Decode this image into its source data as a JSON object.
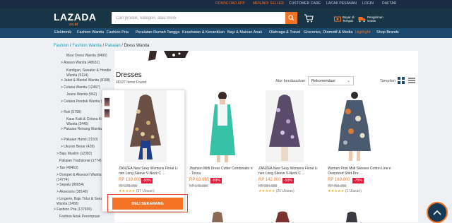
{
  "topbar": {
    "links": [
      "DOWNLOAD APP",
      "MENJADI SELLER",
      "CUSTOMER CARE",
      "LACAK PESANAN",
      "LOGIN",
      "DAFTAR"
    ]
  },
  "header": {
    "logo": "LAZADA",
    "logo_sub": ".co.id",
    "search_placeholder": "Cari produk, kategori, atau merk",
    "util1": "Bayar di Tempat",
    "util2": "Pengiriman Gratis"
  },
  "nav": {
    "items": [
      "Elektronik",
      "Fashion Wanita",
      "Fashion Pria",
      "Peralatan Rumah Tangga",
      "Kesehatan & Kecantikan",
      "Bayi & Mainan Anak",
      "Olahraga & Travel",
      "Groceries, Otomotif & Media",
      "Highlight",
      "Shop Brands"
    ]
  },
  "breadcrumb": {
    "fashion": "Fashion",
    "wanita": "Fashion Wanita",
    "pakaian": "Pakaian",
    "current": "Dress Wanita",
    "sep": "/"
  },
  "sidebar": {
    "items": [
      "Maxi Dress Wanita (8490)",
      "> Atasan Wanita (48631)",
      "Kardigan, Sweater & Hoodie Wanita (9114)",
      "> Jaket & Mantel Wanita (8198)",
      "> Celana Wanita (12467)",
      "Jeans Wanita (962)",
      "> Celana Pendek Wanita (1584)",
      "> Rok (5799)",
      "Kaus Kaki & Celana Ketat Wanita (3445)",
      "> Pakaian Renang Wanita (1663)",
      "> Pakaian Hamil (2150)",
      "> Ukuran Besar (439)",
      "> Baju Muslim (12082)",
      "Pakaian Tradisional (1774)",
      "> Tas (48463)",
      "> Dompet & Aksesori Wanita (14774)",
      "> Sepatu (86654)",
      "> Aksesoris (38148)",
      "> Lingerie, Baju Tidur & Sarung Wanita (3458)",
      "> Fashion Pria (137936)",
      "Fashion Anak Perempuan"
    ]
  },
  "listing": {
    "title": "Dresses",
    "count": "48327 Items Found",
    "sort_label": "Atur berdasarkan:",
    "sort_value": "Rekomendasi",
    "view_label": "Tampilan"
  },
  "products": [
    {
      "name": "ZANZEA New Sexy Womens Floral Li nen Long Sleeve V-Neck C ...",
      "price": "RP 139.000",
      "discount": "-50%",
      "old_price": "RP 278.000",
      "rating": "(37 Ulasan)"
    },
    {
      "name": "Jfashion Midi Dress Cutter Combinatio n - Tosca",
      "price": "RP 63.665",
      "discount": "-58%",
      "old_price": "RP 149.900",
      "rating": ""
    },
    {
      "name": "ZANZEA New Sexy Womens Floral Li nen Long Sleeve V-Neck C ...",
      "price": "RP 142.000",
      "discount": "-50%",
      "old_price": "RP 284.000",
      "rating": "(26 Ulasan)"
    },
    {
      "name": "Women Print Midi Sleeves Cotton Line n Oversized Shirt Dre ...",
      "price": "RP 169.000",
      "discount": "-75%",
      "old_price": "RP 756.000",
      "rating": "(1 Ulasan)"
    }
  ],
  "buy_button": "BELI SEKARANG",
  "colors": {
    "accent": "#f57224",
    "header_bg": "#183545",
    "nav_bg": "#1b4a6d",
    "discount": "#e21b3c",
    "link": "#1a9cb7"
  }
}
